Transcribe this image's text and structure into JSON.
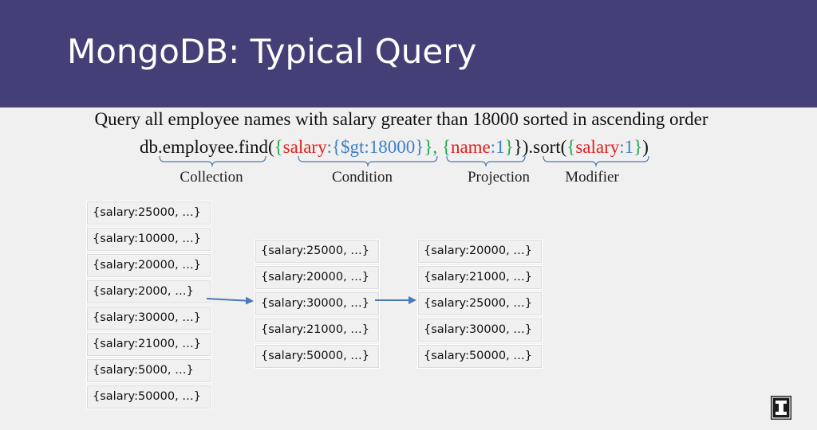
{
  "slide": {
    "title": "MongoDB: Typical Query",
    "description": "Query all employee names with salary greater than 18000 sorted in ascending order"
  },
  "query": {
    "prefix": "db.employee.find(",
    "condition_open": "{",
    "condition_key": "salary",
    "condition_colon": ":",
    "condition_value": "{$gt:18000}",
    "condition_close": "}",
    "separator": ", ",
    "projection_open": "{",
    "projection_key": "name",
    "projection_colon": ":",
    "projection_value": "1",
    "projection_close": "}",
    "find_close": "}).sort(",
    "modifier_open": "{",
    "modifier_key": "salary",
    "modifier_colon": ":",
    "modifier_value": "1",
    "modifier_close": "}",
    "end": ")"
  },
  "labels": {
    "collection": "Collection",
    "condition": "Condition",
    "projection": "Projection",
    "modifier": "Modifier"
  },
  "collection_docs": [
    "{salary:25000, …}",
    "{salary:10000, …}",
    "{salary:20000, …}",
    "{salary:2000, …}",
    "{salary:30000, …}",
    "{salary:21000, …}",
    "{salary:5000, …}",
    "{salary:50000, …}"
  ],
  "filtered_docs": [
    "{salary:25000, …}",
    "{salary:20000, …}",
    "{salary:30000, …}",
    "{salary:21000, …}",
    "{salary:50000, …}"
  ],
  "sorted_docs": [
    "{salary:20000, …}",
    "{salary:21000, …}",
    "{salary:25000, …}",
    "{salary:30000, …}",
    "{salary:50000, …}"
  ],
  "colors": {
    "header": "#453f77",
    "key": "#e02020",
    "brace": "#1fa84d",
    "value": "#3c7fc8",
    "arrow": "#4a79b5"
  },
  "logo_icon": "university-block-i-logo"
}
